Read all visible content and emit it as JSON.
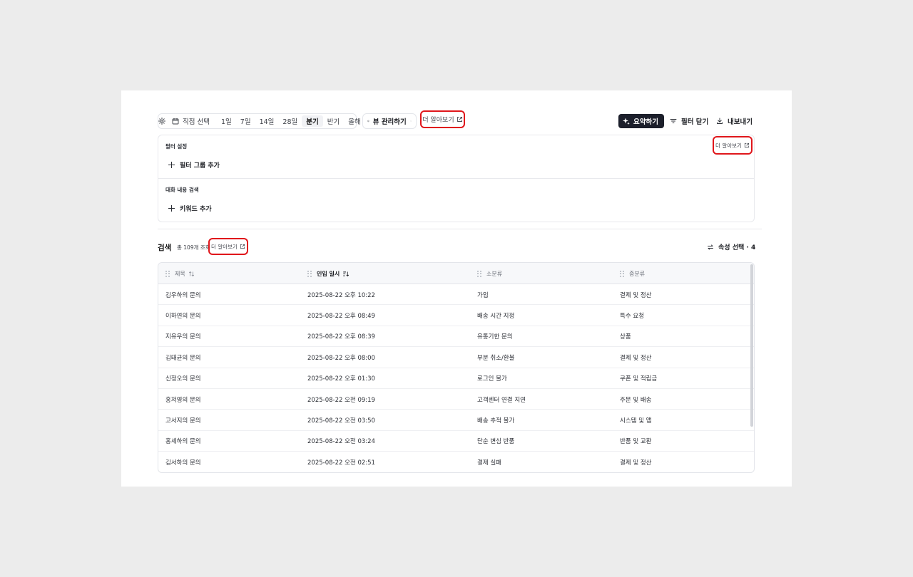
{
  "toolbar": {
    "date_select": "직접 선택",
    "periods": [
      "1일",
      "7일",
      "14일",
      "28일",
      "분기",
      "반기",
      "올해"
    ],
    "active_period": "분기",
    "view_manage": "뷰 관리하기",
    "learn_more": "더 알아보기",
    "summarize": "요약하기",
    "close_filter": "필터 닫기",
    "export": "내보내기"
  },
  "filter": {
    "settings_title": "필터 설정",
    "learn_more": "더 알아보기",
    "add_group": "필터 그룹 추가",
    "conversation_title": "대화 내용 검색",
    "add_keyword": "키워드 추가"
  },
  "search": {
    "title": "검색",
    "count": "총 109개 조회",
    "learn_more": "더 알아보기",
    "attribute_select": "속성 선택 · 4"
  },
  "table": {
    "columns": [
      "제목",
      "인입 일시",
      "소분류",
      "중분류"
    ],
    "rows": [
      [
        "김우하의 문의",
        "2025-08-22 오후 10:22",
        "가입",
        "결제 및 정산"
      ],
      [
        "이하연의 문의",
        "2025-08-22 오후 08:49",
        "배송 시간 지정",
        "특수 요청"
      ],
      [
        "지유우의 문의",
        "2025-08-22 오후 08:39",
        "유통기한 문의",
        "상품"
      ],
      [
        "김태균의 문의",
        "2025-08-22 오후 08:00",
        "부분 취소/환불",
        "결제 및 정산"
      ],
      [
        "신정오의 문의",
        "2025-08-22 오후 01:30",
        "로그인 불가",
        "쿠폰 및 적립금"
      ],
      [
        "홍저영의 문의",
        "2025-08-22 오전 09:19",
        "고객센터 연결 지연",
        "주문 및 배송"
      ],
      [
        "고서지의 문의",
        "2025-08-22 오전 03:50",
        "배송 추적 불가",
        "시스템 및 앱"
      ],
      [
        "홍세하의 문의",
        "2025-08-22 오전 03:24",
        "단순 변심 반품",
        "반품 및 교환"
      ],
      [
        "김서하의 문의",
        "2025-08-22 오전 02:51",
        "결제 실패",
        "결제 및 정산"
      ]
    ]
  },
  "colors": {
    "highlight": "#e0161b",
    "primary_button": "#1c1f2b"
  }
}
